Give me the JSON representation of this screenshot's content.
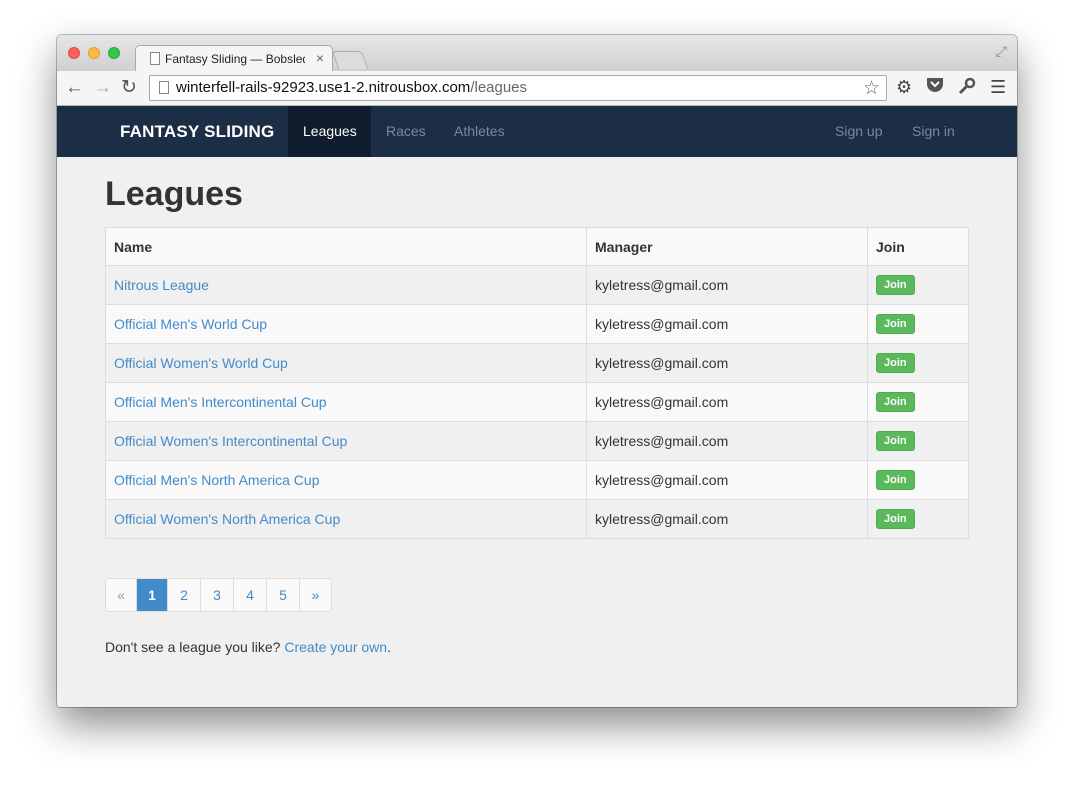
{
  "browser": {
    "tab_title": "Fantasy Sliding — Bobsled",
    "tab_close": "×",
    "url_host": "winterfell-rails-92923.use1-2.nitrousbox.com",
    "url_path": "/leagues",
    "icons": {
      "back": "arrow-left-icon",
      "forward": "arrow-right-icon",
      "reload": "reload-icon",
      "star": "star-icon",
      "gear": "gear-icon",
      "pocket": "pocket-icon",
      "wrench": "wrench-icon",
      "menu": "menu-icon"
    }
  },
  "navbar": {
    "brand": "FANTASY SLIDING",
    "items": [
      {
        "label": "Leagues",
        "active": true
      },
      {
        "label": "Races"
      },
      {
        "label": "Athletes"
      }
    ],
    "right": [
      {
        "label": "Sign up"
      },
      {
        "label": "Sign in"
      }
    ]
  },
  "main": {
    "title": "Leagues",
    "table": {
      "headers": [
        "Name",
        "Manager",
        "Join"
      ],
      "rows": [
        {
          "name": "Nitrous League",
          "manager": "kyletress@gmail.com",
          "join": "Join"
        },
        {
          "name": "Official Men's World Cup",
          "manager": "kyletress@gmail.com",
          "join": "Join"
        },
        {
          "name": "Official Women's World Cup",
          "manager": "kyletress@gmail.com",
          "join": "Join"
        },
        {
          "name": "Official Men's Intercontinental Cup",
          "manager": "kyletress@gmail.com",
          "join": "Join"
        },
        {
          "name": "Official Women's Intercontinental Cup",
          "manager": "kyletress@gmail.com",
          "join": "Join"
        },
        {
          "name": "Official Men's North America Cup",
          "manager": "kyletress@gmail.com",
          "join": "Join"
        },
        {
          "name": "Official Women's North America Cup",
          "manager": "kyletress@gmail.com",
          "join": "Join"
        }
      ]
    },
    "pagination": {
      "prev": "«",
      "pages": [
        "1",
        "2",
        "3",
        "4",
        "5"
      ],
      "current": "1",
      "next": "»"
    },
    "footer": {
      "text": "Don't see a league you like?",
      "link": "Create your own",
      "suffix": "."
    }
  },
  "colors": {
    "navbar": "#1c2e45",
    "link": "#428bca",
    "join_button": "#5cb85c"
  }
}
